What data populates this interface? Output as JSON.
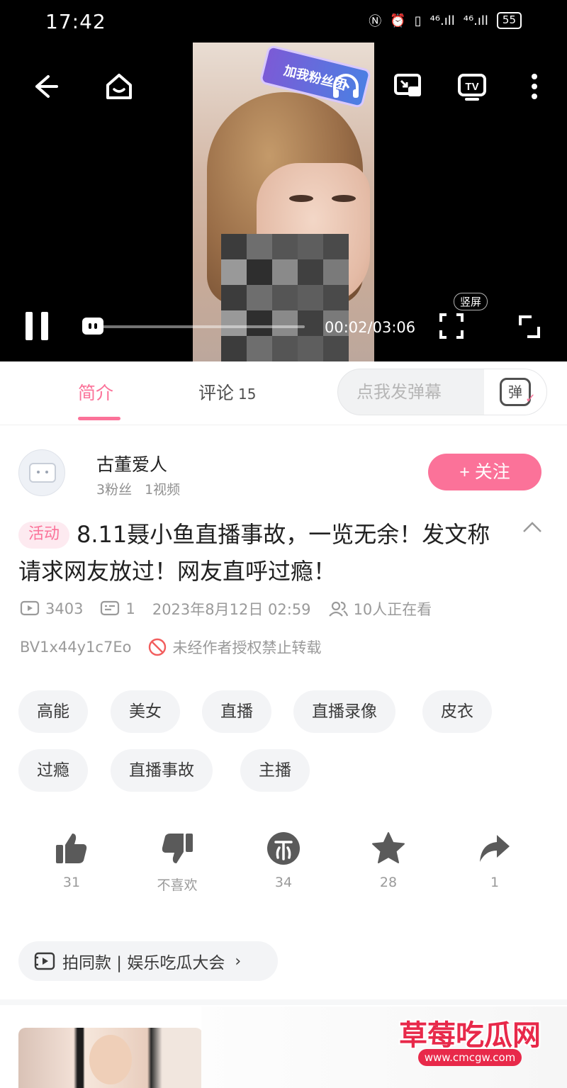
{
  "status_bar": {
    "time": "17:42",
    "signal_1": "⁴⁶.ıll",
    "signal_2": "⁴⁶.ıll",
    "battery": "55"
  },
  "player": {
    "sticker_text": "加我粉丝团",
    "time_readout": "00:02/03:06",
    "portrait_label": "竖屏",
    "progress_fraction": 0.011
  },
  "tabs": {
    "intro": "简介",
    "comments": "评论",
    "comments_count": "15",
    "danmaku_placeholder": "点我发弹幕",
    "danmaku_icon_text": "弹"
  },
  "uploader": {
    "name": "古董爱人",
    "fans": "3粉丝",
    "videos": "1视频",
    "follow_label": "+ 关注"
  },
  "video": {
    "activity_tag": "活动",
    "title": "8.11聂小鱼直播事故，一览无余！发文称请求网友放过！网友直呼过瘾！",
    "views": "3403",
    "danmaku_count": "1",
    "date": "2023年8月12日 02:59",
    "watching": "10人正在看",
    "bvid": "BV1x44y1c7Eo",
    "no_repost": "未经作者授权禁止转载"
  },
  "tags": [
    "高能",
    "美女",
    "直播",
    "直播录像",
    "皮衣",
    "过瘾",
    "直播事故",
    "主播"
  ],
  "actions": {
    "like": "31",
    "dislike": "不喜欢",
    "coin": "34",
    "favorite": "28",
    "share": "1"
  },
  "template": {
    "label": "拍同款 | 娱乐吃瓜大会",
    "chevron": "›"
  },
  "watermark": {
    "title": "草莓吃瓜网",
    "url": "www.cmcgw.com"
  },
  "colors": {
    "accent": "#fb7299",
    "video_bg": "#000000",
    "chip_bg": "#f3f4f6"
  },
  "icons": [
    "back-icon",
    "home-icon",
    "headphones-icon",
    "cast-icon",
    "tv-icon",
    "more-icon",
    "pause-icon",
    "vertical-fullscreen-icon",
    "fullscreen-icon",
    "collapse-icon",
    "play-count-icon",
    "danmaku-icon",
    "viewers-icon",
    "forbidden-icon",
    "thumb-up-icon",
    "thumb-down-icon",
    "coin-icon",
    "star-icon",
    "share-icon",
    "template-icon"
  ]
}
